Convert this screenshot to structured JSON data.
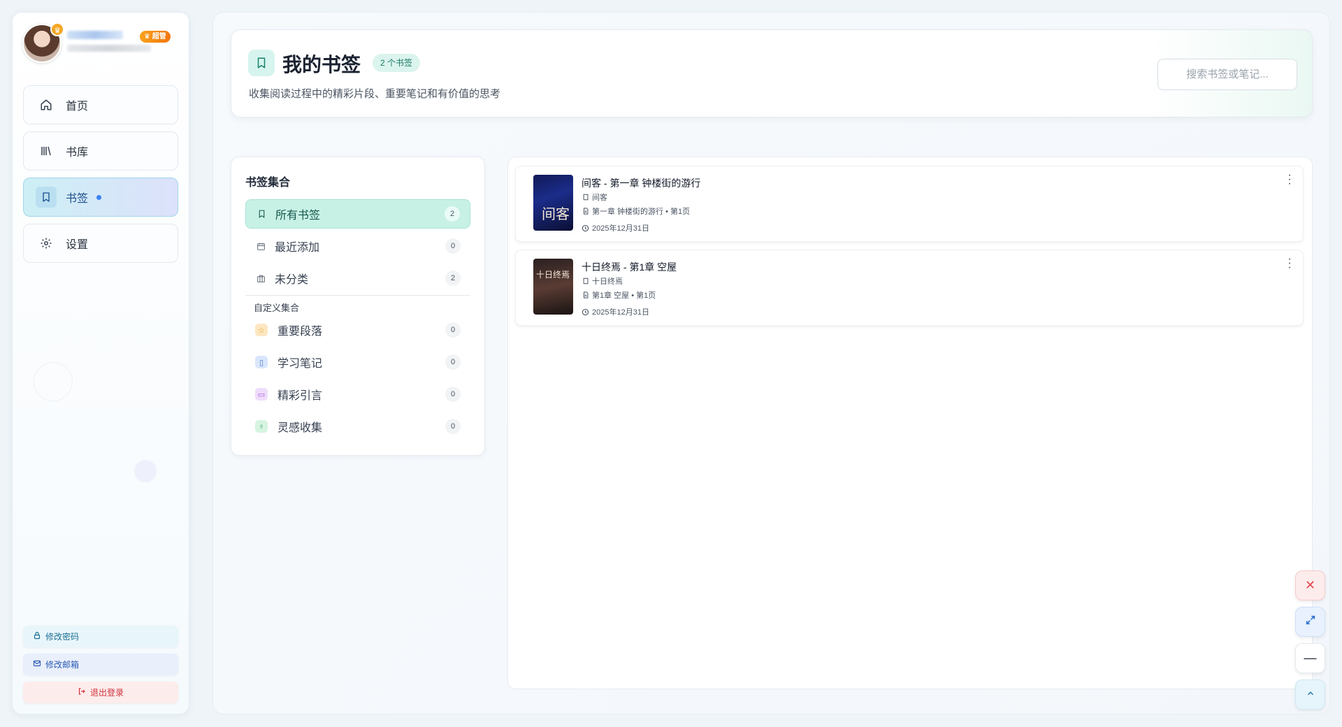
{
  "sidebar": {
    "admin_badge": "♛ 超管",
    "nav": [
      {
        "label": "首页",
        "icon": "home-icon"
      },
      {
        "label": "书库",
        "icon": "library-icon"
      },
      {
        "label": "书签",
        "icon": "bookmark-icon",
        "active": true
      },
      {
        "label": "设置",
        "icon": "gear-icon"
      }
    ],
    "change_password": "修改密码",
    "change_email": "修改邮箱",
    "logout": "退出登录"
  },
  "header": {
    "title": "我的书签",
    "count_badge": "2 个书签",
    "description": "收集阅读过程中的精彩片段、重要笔记和有价值的思考",
    "search_placeholder": "搜索书签或笔记..."
  },
  "collections": {
    "title": "书签集合",
    "items": [
      {
        "label": "所有书签",
        "count": "2",
        "icon": "bookmark-icon"
      },
      {
        "label": "最近添加",
        "count": "0",
        "icon": "calendar-icon"
      },
      {
        "label": "未分类",
        "count": "2",
        "icon": "archive-icon"
      }
    ],
    "custom_title": "自定义集合",
    "custom_items": [
      {
        "label": "重要段落",
        "count": "0",
        "icon": "star-icon",
        "color": "#fde7c2"
      },
      {
        "label": "学习笔记",
        "count": "0",
        "icon": "book-icon",
        "color": "#d9e6fb"
      },
      {
        "label": "精彩引言",
        "count": "0",
        "icon": "quote-icon",
        "color": "#efdcfb"
      },
      {
        "label": "灵感收集",
        "count": "0",
        "icon": "bulb-icon",
        "color": "#d6f4e1"
      }
    ]
  },
  "bookmarks": [
    {
      "title": "间客 - 第一章 钟楼街的游行",
      "book": "间客",
      "chapter": "第一章 钟楼街的游行 • 第1页",
      "date": "2025年12月31日",
      "cover_text": "间客"
    },
    {
      "title": "十日终焉 - 第1章 空屋",
      "book": "十日终焉",
      "chapter": "第1章 空屋 • 第1页",
      "date": "2025年12月31日",
      "cover_text": "十日终焉"
    }
  ],
  "colors": {
    "accent": "#16574a",
    "active_nav": "#1d4f8c",
    "danger": "#d0323a"
  }
}
